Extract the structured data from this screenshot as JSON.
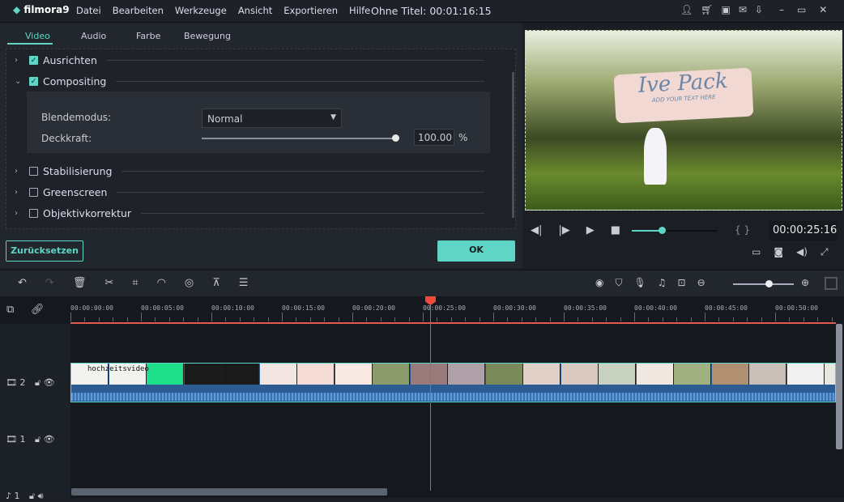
{
  "app": {
    "logo": "filmora9",
    "menu": [
      "Datei",
      "Bearbeiten",
      "Werkzeuge",
      "Ansicht",
      "Exportieren",
      "Hilfe"
    ],
    "title": "Ohne Titel: 00:01:16:15",
    "window_icons": [
      "user-icon",
      "cart-icon",
      "save-icon",
      "mail-icon",
      "download-icon",
      "minimize-icon",
      "maximize-icon",
      "close-icon"
    ]
  },
  "tabs": [
    "Video",
    "Audio",
    "Farbe",
    "Bewegung"
  ],
  "sections": [
    {
      "label": "Ausrichten",
      "checked": true
    },
    {
      "label": "Compositing",
      "checked": true,
      "expanded": true
    },
    {
      "label": "Stabilisierung",
      "checked": false
    },
    {
      "label": "Greenscreen",
      "checked": false
    },
    {
      "label": "Objektivkorrektur",
      "checked": false
    }
  ],
  "compositing": {
    "blend_label": "Blendemodus:",
    "blend_value": "Normal",
    "opacity_label": "Deckkraft:",
    "opacity_value": "100.00",
    "opacity_unit": "%",
    "opacity_percent": 100
  },
  "buttons": {
    "reset": "Zurücksetzen",
    "ok": "OK"
  },
  "preview": {
    "overlay_title": "Ive Pack",
    "overlay_sub": "ADD YOUR TEXT HERE",
    "timecode": "00:00:25:16",
    "progress_percent": 35,
    "brackets": "{  }"
  },
  "ruler": [
    "00:00:00:00",
    "00:00:05:00",
    "00:00:10:00",
    "00:00:15:00",
    "00:00:20:00",
    "00:00:25:00",
    "00:00:30:00",
    "00:00:35:00",
    "00:00:40:00",
    "00:00:45:00",
    "00:00:50:00"
  ],
  "tracks": {
    "video2": "2",
    "video1": "1",
    "audio1": "1",
    "clip_title": "hochzeitsvideo"
  },
  "colors": {
    "accent": "#5fd5c5",
    "playhead": "#f04a3c",
    "bg": "#22262d"
  }
}
